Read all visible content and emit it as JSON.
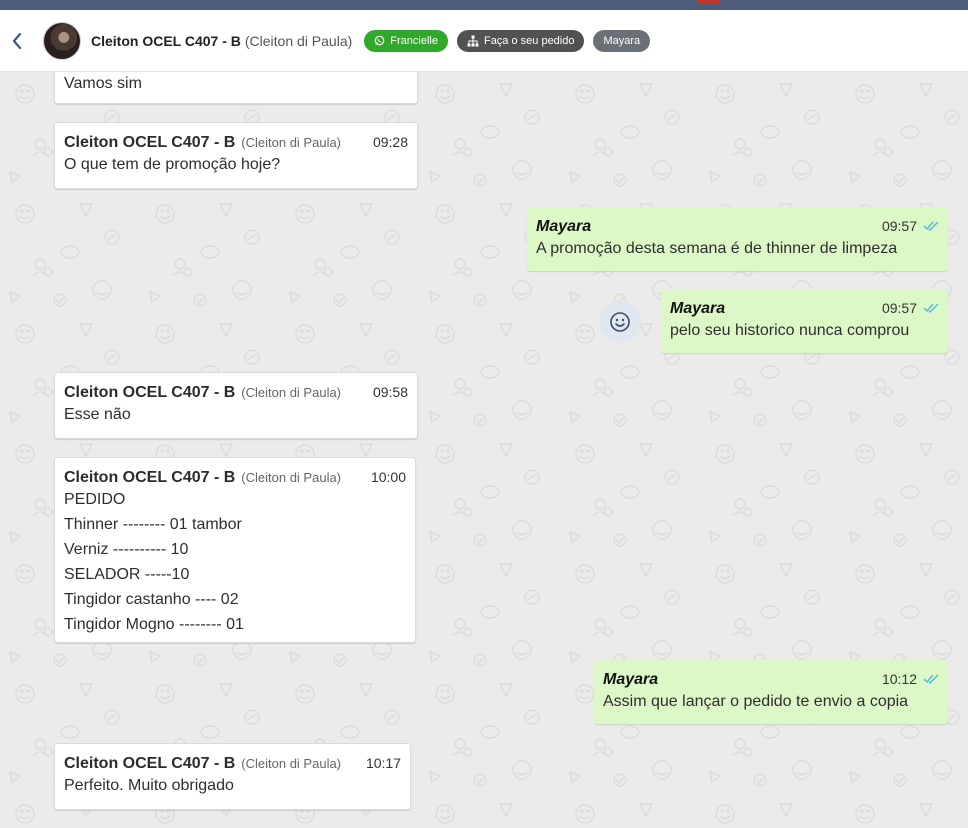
{
  "header": {
    "contact_name": "Cleiton OCEL C407 - B",
    "contact_sub": "(Cleiton di Paula)",
    "tags": [
      {
        "label": "Francielle",
        "icon": "whatsapp-icon",
        "color": "#2fa82c"
      },
      {
        "label": "Faça o seu pedido",
        "icon": "sitemap-icon",
        "color": "#525252"
      },
      {
        "label": "Mayara",
        "color": "#6b6f76"
      }
    ]
  },
  "colors": {
    "outgoing_bubble": "#dcf8c6",
    "incoming_bubble": "#ffffff",
    "read_ticks": "#4fb6e8",
    "chat_background": "#ebebeb"
  },
  "messages": [
    {
      "direction": "in",
      "lines": [
        "Vamos sim"
      ]
    },
    {
      "direction": "in",
      "sender": "Cleiton OCEL C407 - B",
      "sender_sub": "(Cleiton di Paula)",
      "time": "09:28",
      "lines": [
        "O que tem de promoção hoje?"
      ]
    },
    {
      "direction": "out",
      "sender": "Mayara",
      "time": "09:57",
      "lines": [
        "A promoção desta semana é de thinner de limpeza"
      ]
    },
    {
      "direction": "out",
      "sender": "Mayara",
      "time": "09:57",
      "lines": [
        "pelo seu historico nunca comprou"
      ]
    },
    {
      "direction": "in",
      "sender": "Cleiton OCEL C407 - B",
      "sender_sub": "(Cleiton di Paula)",
      "time": "09:58",
      "lines": [
        "Esse não"
      ]
    },
    {
      "direction": "in",
      "sender": "Cleiton OCEL C407 - B",
      "sender_sub": "(Cleiton di Paula)",
      "time": "10:00",
      "lines": [
        "PEDIDO",
        "Thinner -------- 01 tambor",
        "Verniz ---------- 10",
        "SELADOR -----10",
        "Tingidor castanho ---- 02",
        "Tingidor Mogno -------- 01"
      ]
    },
    {
      "direction": "out",
      "sender": "Mayara",
      "time": "10:12",
      "lines": [
        "Assim que lançar o pedido te envio a copia"
      ]
    },
    {
      "direction": "in",
      "sender": "Cleiton OCEL C407 - B",
      "sender_sub": "(Cleiton di Paula)",
      "time": "10:17",
      "lines": [
        "Perfeito. Muito obrigado"
      ]
    }
  ]
}
